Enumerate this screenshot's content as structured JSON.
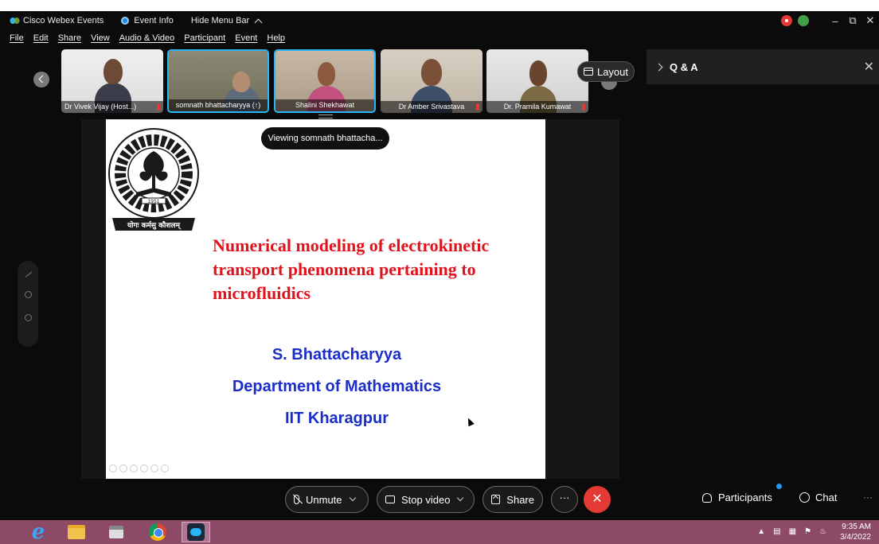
{
  "window": {
    "app_title": "Cisco Webex Events",
    "event_info": "Event Info",
    "hide_menu": "Hide Menu Bar"
  },
  "menu": [
    "File",
    "Edit",
    "Share",
    "View",
    "Audio & Video",
    "Participant",
    "Event",
    "Help"
  ],
  "participants_strip": [
    {
      "name": "Dr Vivek Vijay  (Host...)",
      "muted": true
    },
    {
      "name": "somnath bhattacharyya  (↑)",
      "active": true
    },
    {
      "name": "Shalini Shekhawat",
      "active": true
    },
    {
      "name": "Dr Amber Srivastava",
      "muted": true
    },
    {
      "name": "Dr. Pramila Kumawat",
      "muted": true
    }
  ],
  "layout_label": "Layout",
  "viewing_label": "Viewing somnath bhattacha...",
  "slide": {
    "logo_motto": "योगः कर्मसु कौशलम्",
    "logo_year": "1951",
    "logo_ring": "INDIAN INSTITUTE OF TECHNOLOGY KHARAGPUR",
    "title_lines": [
      "Numerical modeling of electrokinetic",
      "transport phenomena pertaining to",
      "microfluidics"
    ],
    "author": "S. Bhattacharyya",
    "department": "Department of Mathematics",
    "institute": "IIT Kharagpur"
  },
  "qa_panel": {
    "title": "Q & A"
  },
  "controls": {
    "unmute": "Unmute",
    "stop_video": "Stop video",
    "share": "Share",
    "more": "···",
    "participants": "Participants",
    "chat": "Chat"
  },
  "taskbar": {
    "time": "9:35 AM",
    "date": "3/4/2022"
  }
}
